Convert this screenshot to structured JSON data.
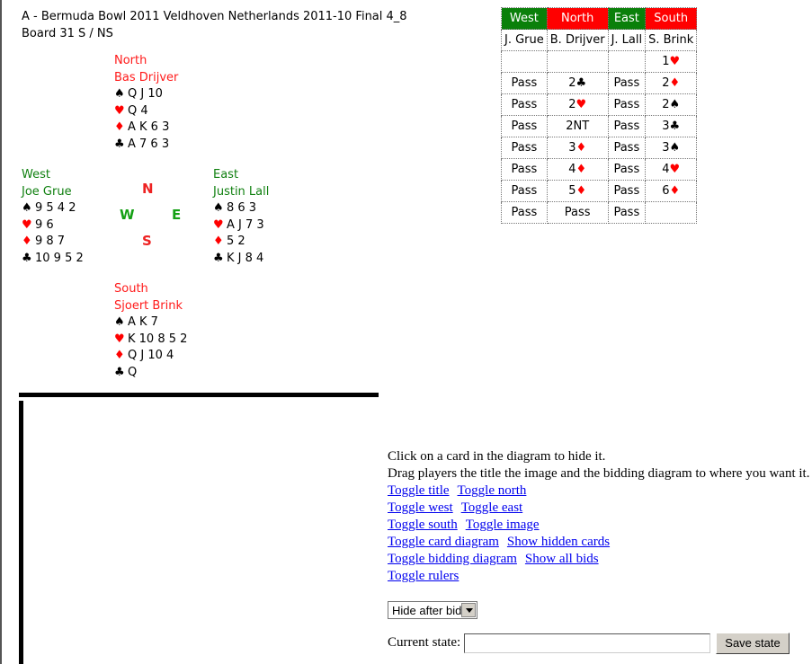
{
  "title": {
    "line1": "A - Bermuda Bowl 2011 Veldhoven Netherlands 2011-10 Final 4_8",
    "line2": "Board 31   S / NS"
  },
  "suits": {
    "spade": "♠",
    "heart": "♥",
    "diamond": "♦",
    "club": "♣"
  },
  "hands": {
    "north": {
      "role": "North",
      "name": "Bas Drijver",
      "spades": "Q J 10",
      "hearts": "Q 4",
      "diamonds": "A K 6 3",
      "clubs": "A 7 6 3"
    },
    "west": {
      "role": "West",
      "name": "Joe Grue",
      "spades": "9 5 4 2",
      "hearts": "9 6",
      "diamonds": "9 8 7",
      "clubs": "10 9 5 2"
    },
    "east": {
      "role": "East",
      "name": "Justin Lall",
      "spades": "8 6 3",
      "hearts": "A J 7 3",
      "diamonds": "5 2",
      "clubs": "K J 8 4"
    },
    "south": {
      "role": "South",
      "name": "Sjoert Brink",
      "spades": "A K 7",
      "hearts": "K 10 8 5 2",
      "diamonds": "Q J 10 4",
      "clubs": "Q"
    }
  },
  "compass": {
    "n": "N",
    "w": "W",
    "e": "E",
    "s": "S"
  },
  "colors": {
    "ns": "#ff0000",
    "ew": "#0a800a"
  },
  "bidding": {
    "headers": [
      "West",
      "North",
      "East",
      "South"
    ],
    "players": [
      "J. Grue",
      "B. Drijver",
      "J. Lall",
      "S. Brink"
    ],
    "rounds": [
      [
        {
          "t": ""
        },
        {
          "t": ""
        },
        {
          "t": ""
        },
        {
          "t": "1",
          "s": "♥"
        }
      ],
      [
        {
          "t": "Pass"
        },
        {
          "t": "2",
          "s": "♣"
        },
        {
          "t": "Pass"
        },
        {
          "t": "2",
          "s": "♦"
        }
      ],
      [
        {
          "t": "Pass"
        },
        {
          "t": "2",
          "s": "♥"
        },
        {
          "t": "Pass"
        },
        {
          "t": "2",
          "s": "♠"
        }
      ],
      [
        {
          "t": "Pass"
        },
        {
          "t": "2NT"
        },
        {
          "t": "Pass"
        },
        {
          "t": "3",
          "s": "♣"
        }
      ],
      [
        {
          "t": "Pass"
        },
        {
          "t": "3",
          "s": "♦"
        },
        {
          "t": "Pass"
        },
        {
          "t": "3",
          "s": "♠"
        }
      ],
      [
        {
          "t": "Pass"
        },
        {
          "t": "4",
          "s": "♦"
        },
        {
          "t": "Pass"
        },
        {
          "t": "4",
          "s": "♥"
        }
      ],
      [
        {
          "t": "Pass"
        },
        {
          "t": "5",
          "s": "♦"
        },
        {
          "t": "Pass"
        },
        {
          "t": "6",
          "s": "♦"
        }
      ],
      [
        {
          "t": "Pass"
        },
        {
          "t": "Pass"
        },
        {
          "t": "Pass"
        },
        {
          "t": ""
        }
      ]
    ]
  },
  "info": {
    "line1": "Click on a card in the diagram to hide it.",
    "line2": "Drag players the title the image and the bidding diagram to where you want it.",
    "links": [
      [
        "Toggle title",
        "Toggle north"
      ],
      [
        "Toggle west",
        "Toggle east"
      ],
      [
        "Toggle south",
        "Toggle image"
      ],
      [
        "Toggle card diagram",
        "Show hidden cards"
      ],
      [
        "Toggle bidding diagram",
        "Show all bids"
      ],
      [
        "Toggle rulers"
      ]
    ]
  },
  "controls": {
    "select_value": "Hide after bid",
    "state_label": "Current state:",
    "state_value": "",
    "save_label": "Save state"
  }
}
